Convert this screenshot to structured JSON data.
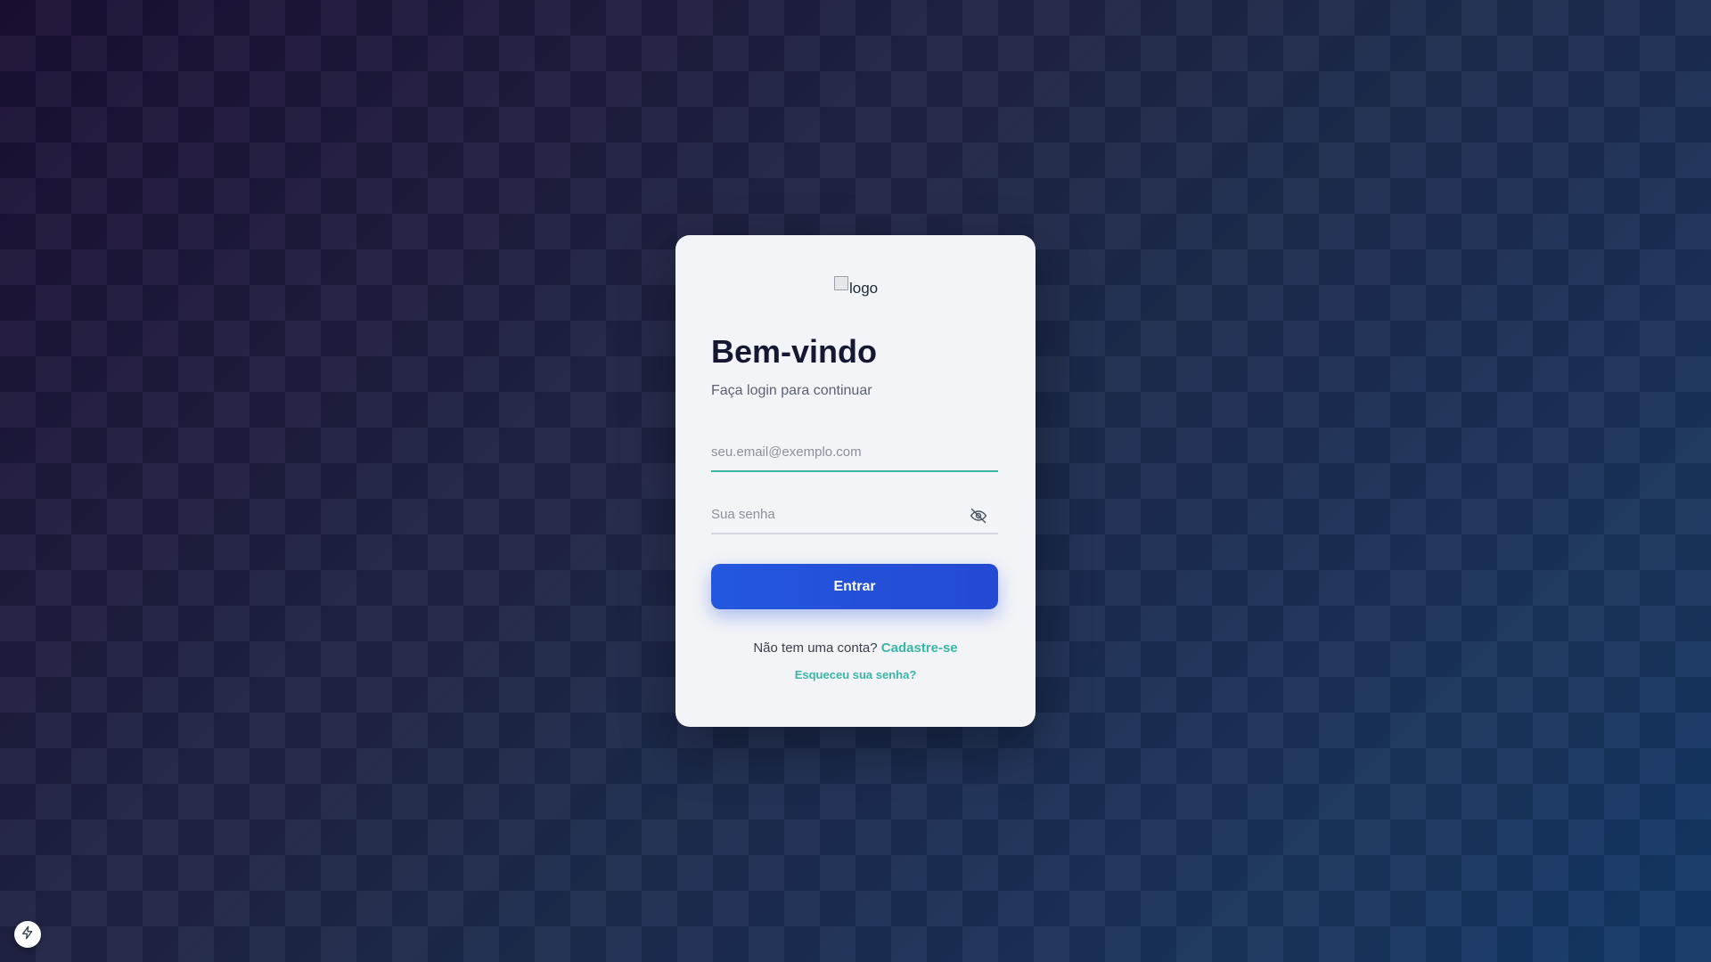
{
  "logo": {
    "alt_text": "logo"
  },
  "header": {
    "title": "Bem-vindo",
    "subtitle": "Faça login para continuar"
  },
  "form": {
    "email_placeholder": "seu.email@exemplo.com",
    "email_value": "",
    "password_placeholder": "Sua senha",
    "password_value": "",
    "submit_label": "Entrar"
  },
  "footer": {
    "signup_prompt": "Não tem uma conta?",
    "signup_link": "Cadastre-se",
    "forgot_link": "Esqueceu sua senha?"
  },
  "icons": {
    "password_toggle": "eye-off-icon",
    "corner_button": "lightning-icon"
  },
  "colors": {
    "accent": "#3bb5a8",
    "primary_button": "#2358de",
    "title": "#151833"
  }
}
